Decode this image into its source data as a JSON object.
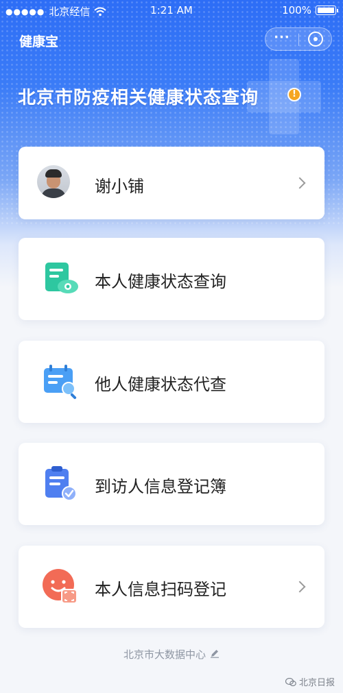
{
  "status_bar": {
    "signal_dots": "●●●●●",
    "carrier": "北京经信",
    "time": "1:21 AM",
    "battery": "100%"
  },
  "nav": {
    "app_title": "健康宝",
    "more_label": "···"
  },
  "page": {
    "title": "北京市防疫相关健康状态查询",
    "info_badge": "!"
  },
  "profile": {
    "name": "谢小铺"
  },
  "menu": [
    {
      "label": "本人健康状态查询",
      "icon": "document-eye-icon",
      "color": "#2ec7a0"
    },
    {
      "label": "他人健康状态代查",
      "icon": "calendar-search-icon",
      "color": "#4a9ff5"
    },
    {
      "label": "到访人信息登记簿",
      "icon": "clipboard-check-icon",
      "color": "#4f7ff0"
    },
    {
      "label": "本人信息扫码登记",
      "icon": "smile-scan-icon",
      "color": "#f26b56"
    }
  ],
  "footer": {
    "text": "北京市大数据中心"
  },
  "watermark": "北京日报",
  "colors": {
    "accent": "#2d6df6",
    "warning": "#f5a623"
  }
}
